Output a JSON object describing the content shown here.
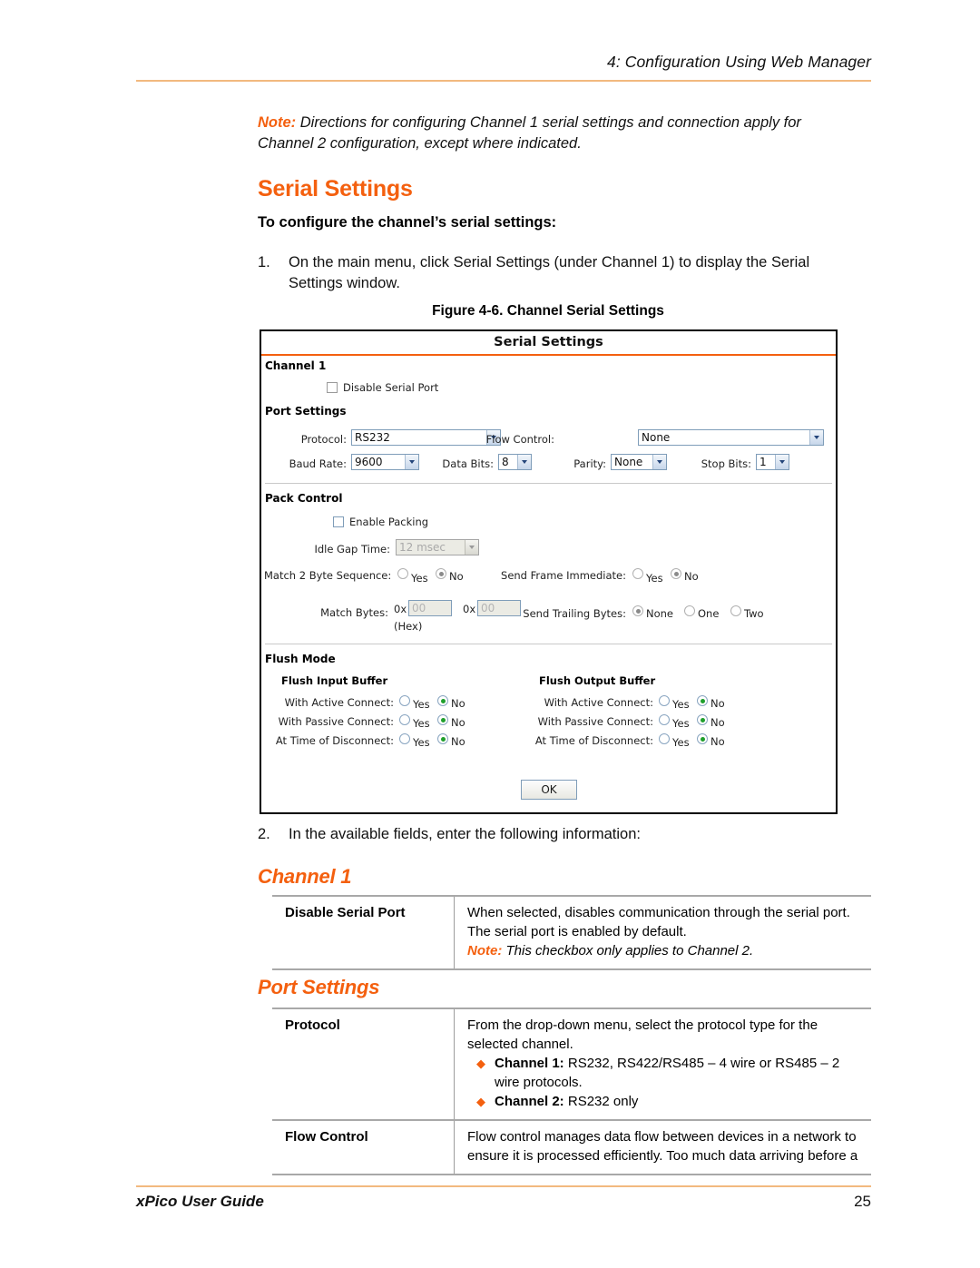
{
  "page": {
    "header_text": "4: Configuration Using Web Manager",
    "footer_left": "xPico User Guide",
    "footer_page_number": "25",
    "accent_orange": "#f4600f",
    "rule_color": "#f2b97f"
  },
  "note_top": {
    "label": "Note:",
    "text": "Directions for configuring Channel 1 serial settings and connection apply for Channel 2 configuration, except where indicated."
  },
  "section": {
    "title": "Serial Settings",
    "subtitle": "To configure the channel’s serial settings:"
  },
  "steps": [
    {
      "number": "1.",
      "text": "On the main menu, click Serial Settings (under Channel 1) to display the Serial Settings window."
    },
    {
      "number": "2.",
      "text": "In the available fields, enter the following information:"
    }
  ],
  "figure": {
    "caption": "Figure 4-6. Channel Serial Settings",
    "window_title": "Serial Settings",
    "channel_heading": "Channel 1",
    "disable_serial_port": {
      "label": "Disable Serial Port",
      "checked": false
    },
    "port_settings": {
      "group_title": "Port Settings",
      "protocol": {
        "label": "Protocol:",
        "value": "RS232"
      },
      "flow_control": {
        "label": "Flow Control:",
        "value": "None"
      },
      "baud_rate": {
        "label": "Baud Rate:",
        "value": "9600"
      },
      "data_bits": {
        "label": "Data Bits:",
        "value": "8"
      },
      "parity": {
        "label": "Parity:",
        "value": "None"
      },
      "stop_bits": {
        "label": "Stop Bits:",
        "value": "1"
      }
    },
    "pack_control": {
      "group_title": "Pack Control",
      "enable_packing": {
        "label": "Enable Packing",
        "checked": false
      },
      "idle_gap_time": {
        "label": "Idle Gap Time:",
        "value": "12 msec",
        "disabled": true
      },
      "match_2_byte_sequence": {
        "label": "Match 2 Byte Sequence:",
        "yes_label": "Yes",
        "no_label": "No",
        "selected": "No"
      },
      "send_frame_immediate": {
        "label": "Send Frame Immediate:",
        "yes_label": "Yes",
        "no_label": "No",
        "selected": "No"
      },
      "match_bytes": {
        "label": "Match Bytes:",
        "hex_note": "(Hex)",
        "prefix": "0x",
        "byte1": "00",
        "byte2": "00"
      },
      "send_trailing_bytes": {
        "label": "Send Trailing Bytes:",
        "options": [
          "None",
          "One",
          "Two"
        ],
        "selected": "None"
      }
    },
    "flush_mode": {
      "group_title": "Flush Mode",
      "input_buffer_title": "Flush Input Buffer",
      "output_buffer_title": "Flush Output Buffer",
      "yes_label": "Yes",
      "no_label": "No",
      "rows": [
        {
          "label": "With Active Connect:",
          "input_selected": "No",
          "output_selected": "No"
        },
        {
          "label": "With Passive Connect:",
          "input_selected": "No",
          "output_selected": "No"
        },
        {
          "label": "At Time of Disconnect:",
          "input_selected": "No",
          "output_selected": "No"
        }
      ]
    },
    "ok_button": "OK"
  },
  "channel_section": {
    "heading": "Channel 1",
    "rows": [
      {
        "key": "Disable Serial Port",
        "line1": "When selected, disables communication through the serial port.",
        "line2": "The serial port is enabled by default.",
        "note_label": "Note:",
        "note_text": "This checkbox only applies to Channel 2."
      }
    ]
  },
  "port_settings_section": {
    "heading": "Port Settings",
    "protocol_row": {
      "key": "Protocol",
      "line1": "From the drop-down menu, select the protocol type for the",
      "line2": "selected channel.",
      "bullets": [
        {
          "bold": "Channel 1:",
          "text": " RS232, RS422/RS485 – 4 wire or RS485 – 2 wire protocols."
        },
        {
          "bold": "Channel 2:",
          "text": " RS232 only"
        }
      ]
    },
    "flow_control_row": {
      "key": "Flow Control",
      "line1": "Flow control manages data flow between devices in a network to",
      "line2": "ensure it is processed efficiently. Too much data arriving before a"
    }
  }
}
